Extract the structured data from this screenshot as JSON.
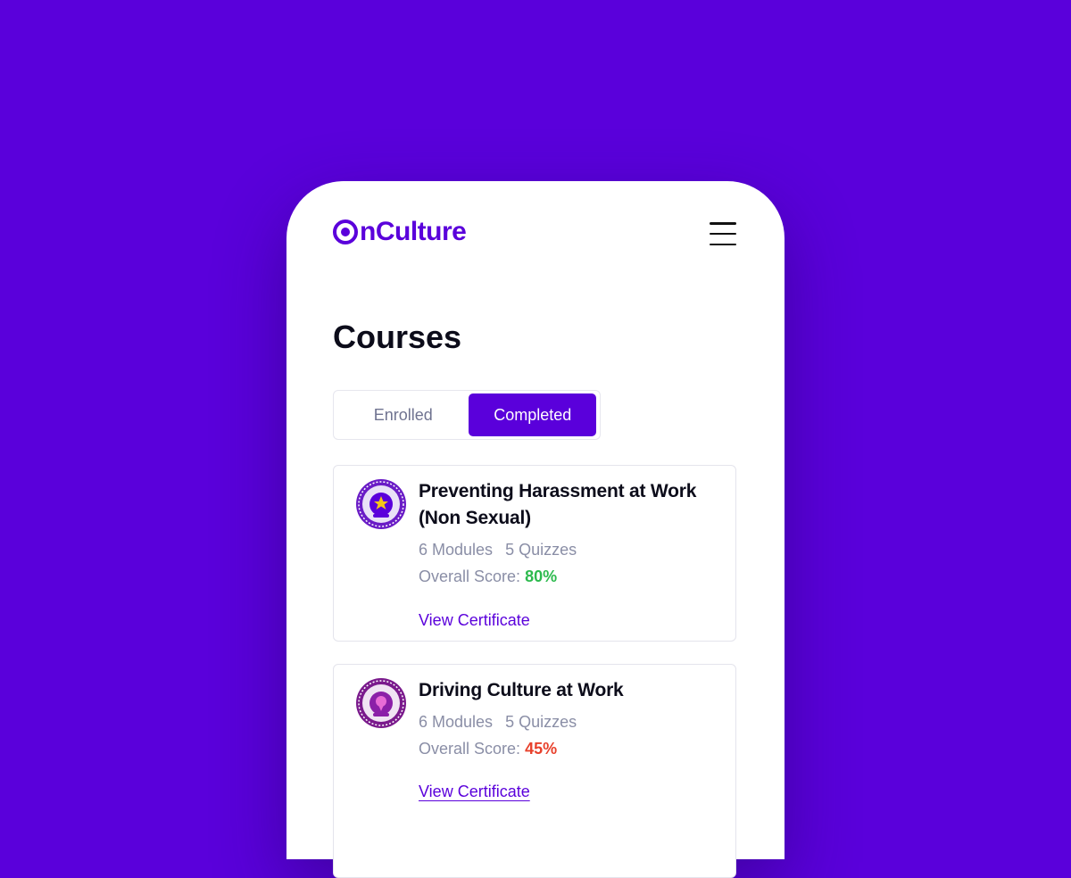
{
  "app": {
    "logo_text": "nCulture",
    "brand_color": "#5a00db"
  },
  "header": {
    "menu_icon": "hamburger-menu-icon"
  },
  "page": {
    "title": "Courses"
  },
  "tabs": [
    {
      "label": "Enrolled",
      "active": false
    },
    {
      "label": "Completed",
      "active": true
    }
  ],
  "courses": [
    {
      "title": "Preventing Harassment at Work (Non Sexual)",
      "modules": "6 Modules",
      "quizzes": "5 Quizzes",
      "score_label": "Overall Score:",
      "score": "80%",
      "score_color": "#2dba4e",
      "link": "View Certificate",
      "badge_icon": "completion-badge-icon"
    },
    {
      "title": "Driving Culture at Work",
      "modules": "6 Modules",
      "quizzes": "5 Quizzes",
      "score_label": "Overall Score:",
      "score": "45%",
      "score_color": "#e8412c",
      "link": "View Certificate",
      "badge_icon": "completion-badge-icon"
    }
  ]
}
